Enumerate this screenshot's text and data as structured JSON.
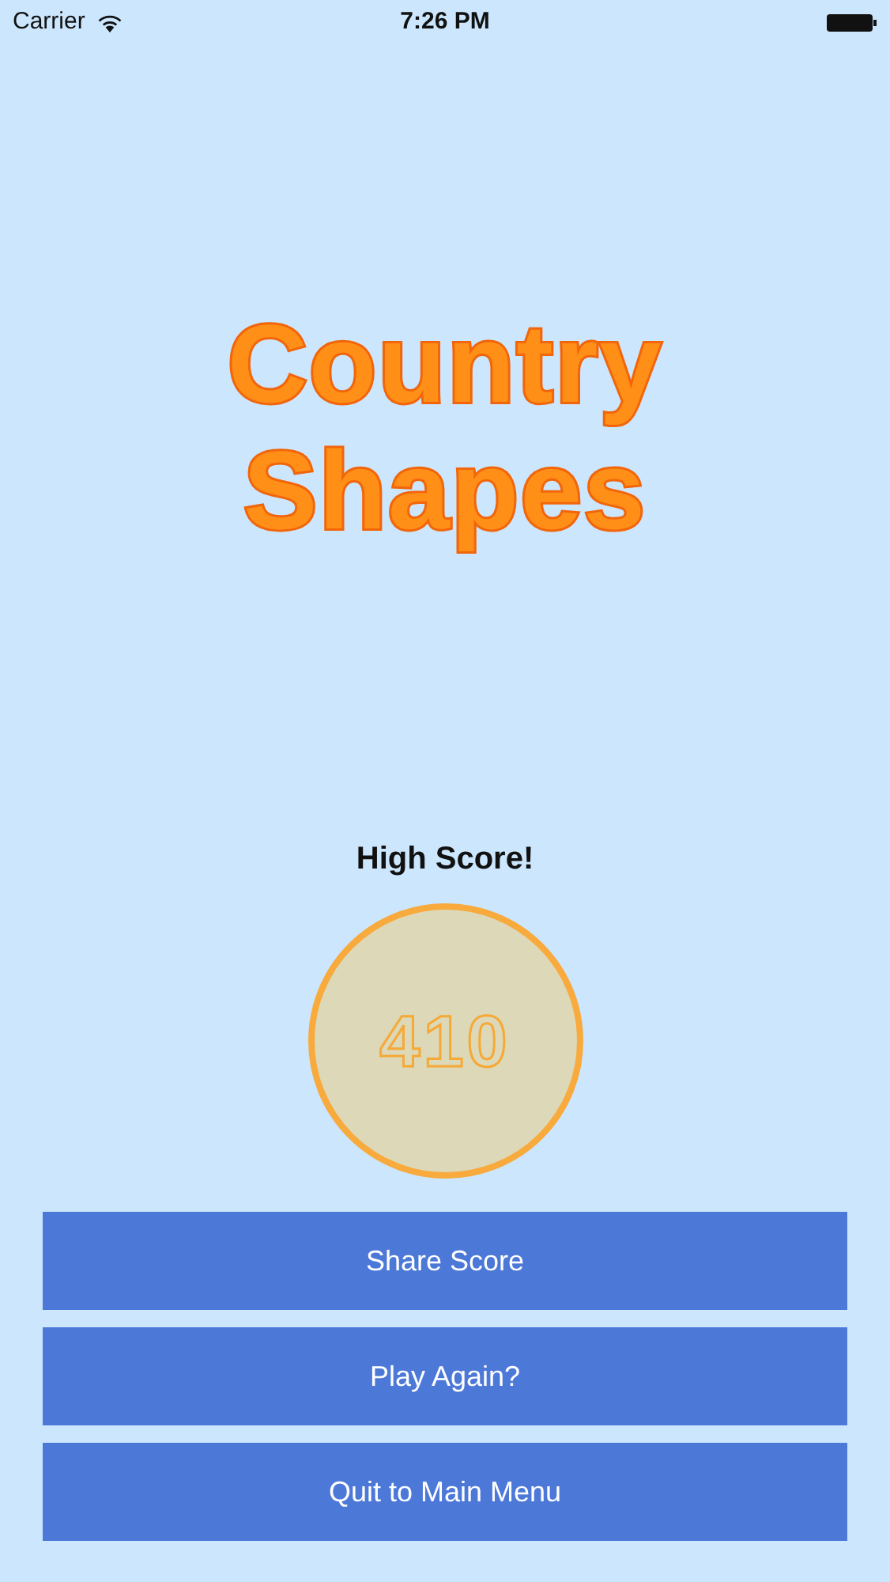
{
  "status_bar": {
    "carrier": "Carrier",
    "time": "7:26 PM"
  },
  "title": [
    "Country",
    "Shapes"
  ],
  "score_label": "High Score!",
  "score": "410",
  "buttons": [
    "Share Score",
    "Play Again?",
    "Quit to Main Menu"
  ]
}
